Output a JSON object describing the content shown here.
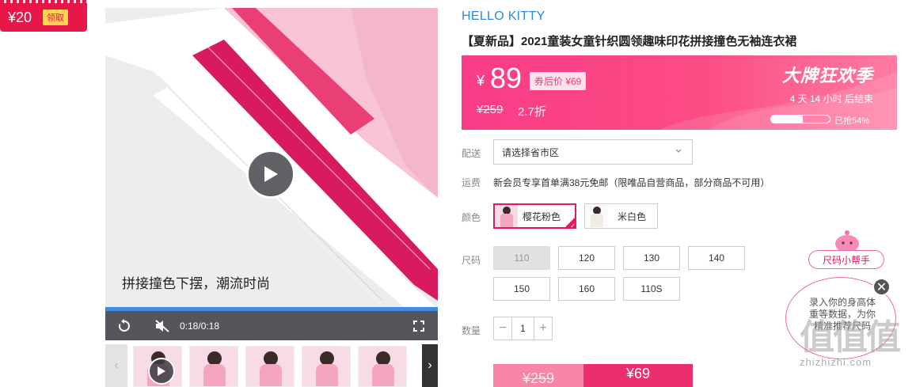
{
  "coupon": {
    "amount": "¥20",
    "claim_label": "领取"
  },
  "video": {
    "caption": "拼接撞色下摆，潮流时尚",
    "time": "0:18/0:18",
    "progress": 1.0
  },
  "product": {
    "brand": "HELLO KITTY",
    "title": "【夏新品】2021童装女童针织圆领趣味印花拼接撞色无袖连衣裙"
  },
  "price": {
    "currency": "¥",
    "current": "89",
    "after_coupon": "券后价 ¥69",
    "original": "¥259",
    "discount": "2.7折",
    "promo_title": "大牌狂欢季",
    "countdown": "4 天 14 小时 后结束",
    "sold_percent": 0.54,
    "sold_text": "已抢54%",
    "accent_color": "#f93c86"
  },
  "shipping": {
    "label": "配送",
    "placeholder": "请选择省市区"
  },
  "freight": {
    "label": "运费",
    "text": "新会员专享首单满38元免邮（限唯品自营商品，部分商品不可用）"
  },
  "color": {
    "label": "颜色",
    "options": [
      {
        "name": "樱花粉色",
        "selected": true
      },
      {
        "name": "米白色",
        "selected": false
      }
    ]
  },
  "size": {
    "label": "尺码",
    "options": [
      "110",
      "120",
      "130",
      "140",
      "150",
      "160",
      "110S"
    ],
    "disabled": [
      "110"
    ]
  },
  "quantity": {
    "label": "数量",
    "value": "1",
    "minus": "−",
    "plus": "+"
  },
  "buy": {
    "original": "¥259",
    "price": "¥69"
  },
  "size_helper": {
    "title": "尺码小帮手",
    "text": "录入你的身高体重等数据，为你精准推荐尺码",
    "close": "✕"
  },
  "watermark": {
    "big": "值值值",
    "small": "zhizhizhi.com"
  },
  "thumbnails": {
    "prev": "‹",
    "next": "›"
  }
}
